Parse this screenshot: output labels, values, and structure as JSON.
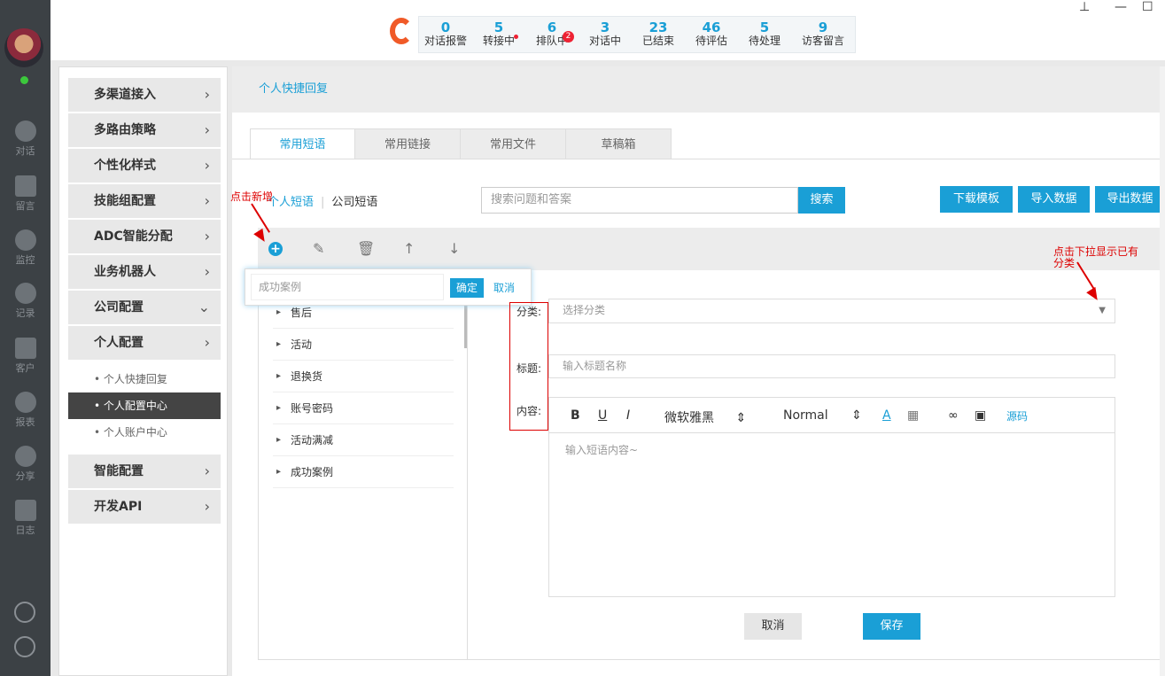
{
  "rail": {
    "items": [
      {
        "label": "对话",
        "icon": "chat-icon"
      },
      {
        "label": "留言",
        "icon": "mail-icon"
      },
      {
        "label": "监控",
        "icon": "eye-icon"
      },
      {
        "label": "记录",
        "icon": "clock-icon"
      },
      {
        "label": "客户",
        "icon": "contact-card-icon"
      },
      {
        "label": "报表",
        "icon": "pie-chart-icon"
      },
      {
        "label": "分享",
        "icon": "share-icon"
      },
      {
        "label": "日志",
        "icon": "clipboard-icon"
      }
    ]
  },
  "stats": [
    {
      "n": "0",
      "l": "对话报警"
    },
    {
      "n": "5",
      "l": "转接中"
    },
    {
      "n": "6",
      "l": "排队中",
      "badge": "2"
    },
    {
      "n": "3",
      "l": "对话中"
    },
    {
      "n": "23",
      "l": "已结束"
    },
    {
      "n": "46",
      "l": "待评估"
    },
    {
      "n": "5",
      "l": "待处理"
    },
    {
      "n": "9",
      "l": "访客留言"
    }
  ],
  "menu": {
    "items": [
      "多渠道接入",
      "多路由策略",
      "个性化样式",
      "技能组配置",
      "ADC智能分配",
      "业务机器人",
      "公司配置",
      "个人配置",
      "智能配置",
      "开发API"
    ],
    "sub_items": [
      "个人快捷回复",
      "个人配置中心",
      "个人账户中心"
    ]
  },
  "breadcrumb": "个人快捷回复",
  "tabs": [
    "常用短语",
    "常用链接",
    "常用文件",
    "草稿箱"
  ],
  "subtabs": {
    "personal": "个人短语",
    "company": "公司短语"
  },
  "search": {
    "placeholder": "搜索问题和答案",
    "button": "搜索"
  },
  "actions": {
    "download": "下载模板",
    "import": "导入数据",
    "export": "导出数据"
  },
  "popover": {
    "input_value": "成功案例",
    "ok": "确定",
    "cancel": "取消"
  },
  "categories": [
    "售后",
    "活动",
    "退换货",
    "账号密码",
    "活动满减",
    "成功案例"
  ],
  "form": {
    "category_label": "分类:",
    "category_placeholder": "选择分类",
    "title_label": "标题:",
    "title_placeholder": "输入标题名称",
    "content_label": "内容:",
    "font": "微软雅黑",
    "size": "Normal",
    "source": "源码",
    "content_placeholder": "输入短语内容~",
    "cancel": "取消",
    "save": "保存"
  },
  "annotations": {
    "add": "点击新增",
    "dropdown_line1": "点击下拉显示已有",
    "dropdown_line2": "分类"
  },
  "colors": {
    "accent": "#1a9fd6",
    "rail": "#3c4145",
    "annotation": "#dd0000"
  }
}
